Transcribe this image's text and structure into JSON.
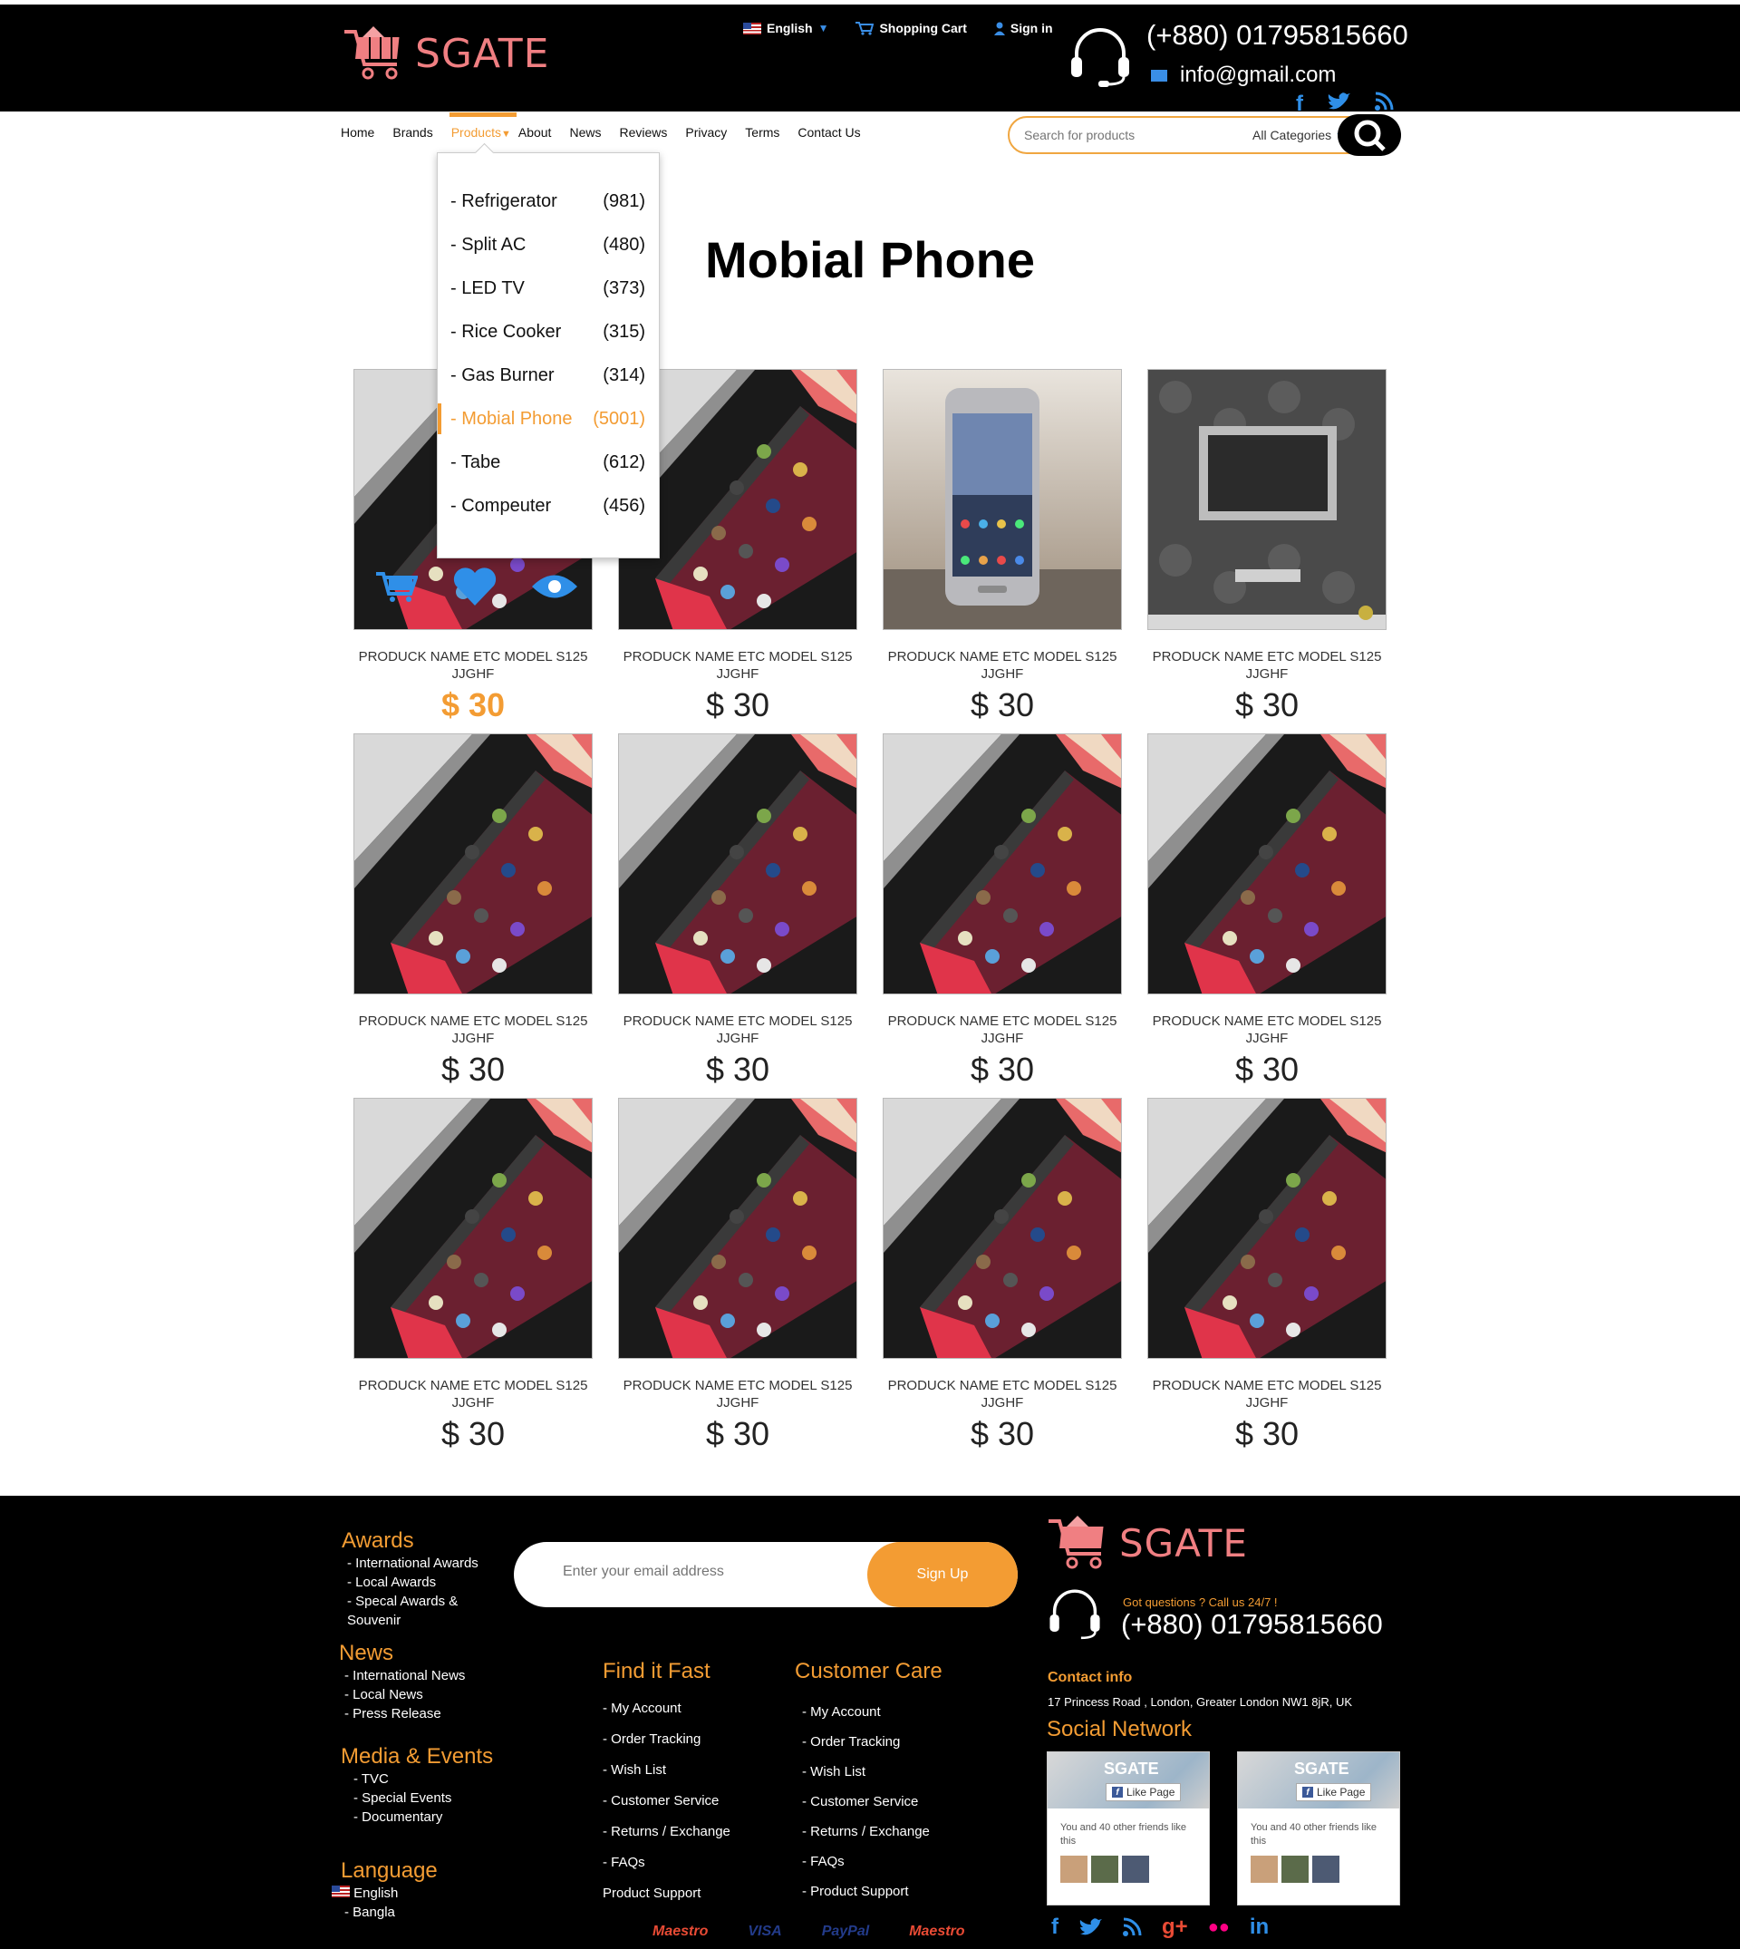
{
  "header": {
    "logo_text": "SGATE",
    "language": "English",
    "cart": "Shopping Cart",
    "signin": "Sign in",
    "phone": "(+880) 01795815660",
    "email": "info@gmail.com"
  },
  "nav": {
    "items": [
      "Home",
      "Brands",
      "Products",
      "About",
      "News",
      "Reviews",
      "Privacy",
      "Terms",
      "Contact Us"
    ],
    "active": "Products",
    "search_placeholder": "Search for products",
    "category": "All Categories"
  },
  "dropdown": {
    "items": [
      {
        "label": "- Refrigerator",
        "count": "(981)"
      },
      {
        "label": "- Split AC",
        "count": "(480)"
      },
      {
        "label": "- LED TV",
        "count": "(373)"
      },
      {
        "label": "- Rice Cooker",
        "count": "(315)"
      },
      {
        "label": "- Gas Burner",
        "count": "(314)"
      },
      {
        "label": "- Mobial Phone",
        "count": "(5001)"
      },
      {
        "label": "- Tabe",
        "count": "(612)"
      },
      {
        "label": "- Compeuter",
        "count": "(456)"
      }
    ],
    "selected": "- Mobial Phone"
  },
  "page_title": "Mobial Phone",
  "product": {
    "name_line1": "PRODUCK NAME ETC  MODEL S125",
    "name_line2": "JJGHF",
    "price": "$ 30"
  },
  "products": [
    {
      "img": "red-phone",
      "highlight": true
    },
    {
      "img": "red-phone"
    },
    {
      "img": "silver-phone"
    },
    {
      "img": "tv-wall"
    },
    {
      "img": "red-phone"
    },
    {
      "img": "red-phone"
    },
    {
      "img": "red-phone"
    },
    {
      "img": "red-phone"
    },
    {
      "img": "red-phone"
    },
    {
      "img": "red-phone"
    },
    {
      "img": "red-phone"
    },
    {
      "img": "red-phone"
    }
  ],
  "footer": {
    "awards": {
      "title": "Awards",
      "items": [
        "- International Awards",
        "- Local Awards",
        "- Specal Awards &",
        "Souvenir"
      ]
    },
    "news": {
      "title": "News",
      "items": [
        "- International News",
        "- Local News",
        "- Press Release"
      ]
    },
    "media": {
      "title": "Media & Events",
      "items": [
        "- TVC",
        "- Special Events",
        "- Documentary"
      ]
    },
    "language": {
      "title": "Language",
      "items": [
        "English",
        "- Bangla"
      ]
    },
    "newsletter_placeholder": "Enter your email address",
    "signup": "Sign Up",
    "find": {
      "title": "Find it Fast",
      "items": [
        "- My Account",
        "- Order Tracking",
        "- Wish List",
        "- Customer Service",
        "- Returns / Exchange",
        "- FAQs",
        "Product Support"
      ]
    },
    "care": {
      "title": "Customer Care",
      "items": [
        "- My Account",
        "- Order Tracking",
        "- Wish List",
        "- Customer Service",
        "- Returns / Exchange",
        "- FAQs",
        "- Product Support"
      ]
    },
    "logo_text": "SGATE",
    "got_questions": "Got questions ? Call us 24/7 !",
    "phone": "(+880) 01795815660",
    "contact_title": "Contact info",
    "address": "17 Princess Road , London, Greater London  NW1 8jR, UK",
    "social_title": "Social Network",
    "fb_title": "SGATE",
    "fb_like": "Like Page",
    "fb_text": "You and 40 other friends like this",
    "payments": [
      "Maestro",
      "VISA",
      "PayPal",
      "Maestro"
    ]
  },
  "colors": {
    "accent": "#f39c33",
    "brand_pink": "#f07f82",
    "blue": "#2f8fe8"
  }
}
